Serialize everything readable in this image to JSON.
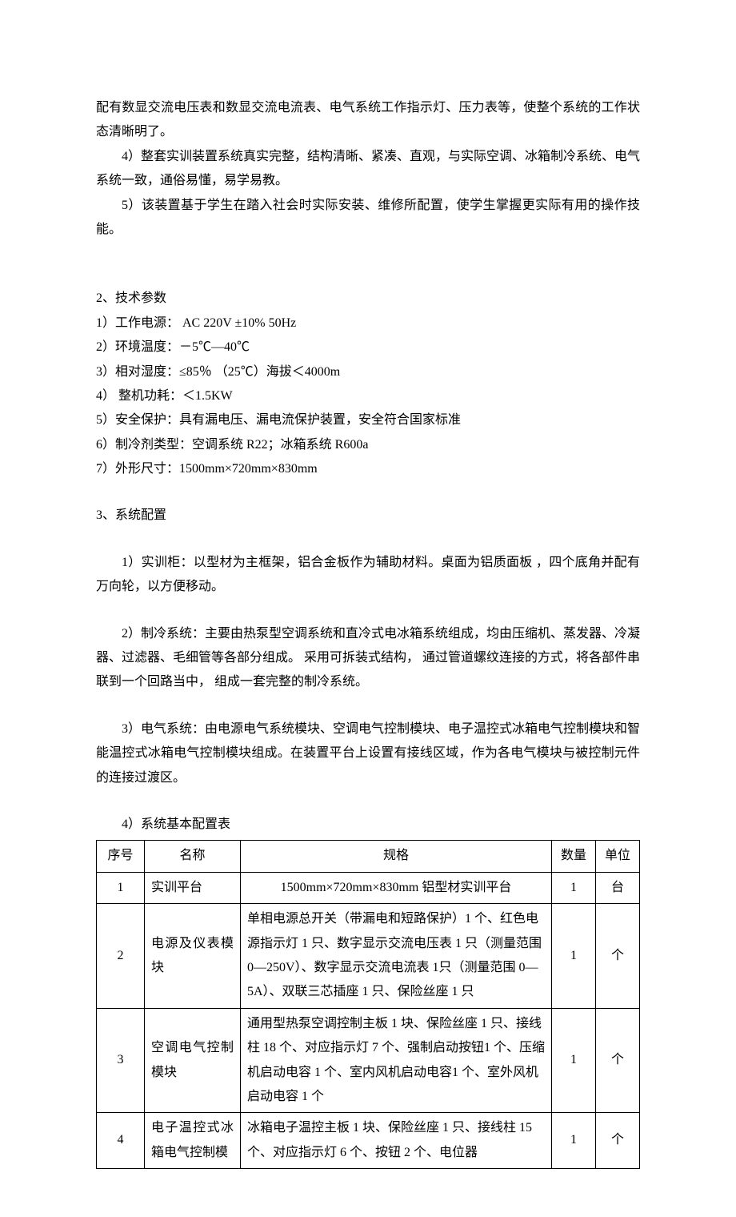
{
  "intro": {
    "p1": "配有数显交流电压表和数显交流电流表、电气系统工作指示灯、压力表等，使整个系统的工作状态清晰明了。",
    "p2": "4）整套实训装置系统真实完整，结构清晰、紧凑、直观，与实际空调、冰箱制冷系统、电气系统一致，通俗易懂，易学易教。",
    "p3": "5）该装置基于学生在踏入社会时实际安装、维修所配置，使学生掌握更实际有用的操作技能。"
  },
  "tech": {
    "title": "2、技术参数",
    "items": [
      "1）工作电源：  AC 220V  ±10%    50Hz",
      "2）环境温度：－5℃—40℃",
      "3）相对湿度：≤85％    （25℃）海拔＜4000m",
      "4）  整机功耗：＜1.5KW",
      "5）安全保护：具有漏电压、漏电流保护装置，安全符合国家标准",
      "6）制冷剂类型：空调系统 R22；冰箱系统 R600a",
      "7）外形尺寸：1500mm×720mm×830mm"
    ]
  },
  "config": {
    "title": "3、系统配置",
    "p1": "1）实训柜：以型材为主框架，铝合金板作为辅助材料。桌面为铝质面板 ，四个底角并配有万向轮，以方便移动。",
    "p2": "2）制冷系统：主要由热泵型空调系统和直冷式电冰箱系统组成，均由压缩机、蒸发器、冷凝器、过滤器、毛细管等各部分组成。  采用可拆装式结构，  通过管道螺纹连接的方式，将各部件串联到一个回路当中，  组成一套完整的制冷系统。",
    "p3": "3）电气系统：由电源电气系统模块、空调电气控制模块、电子温控式冰箱电气控制模块和智能温控式冰箱电气控制模块组成。在装置平台上设置有接线区域，作为各电气模块与被控制元件的连接过渡区。",
    "p4": "4）系统基本配置表"
  },
  "table": {
    "headers": {
      "idx": "序号",
      "name": "名称",
      "spec": "规格",
      "qty": "数量",
      "unit": "单位"
    },
    "rows": [
      {
        "idx": "1",
        "name": "实训平台",
        "spec": "1500mm×720mm×830mm 铝型材实训平台",
        "spec_center": true,
        "qty": "1",
        "unit": "台"
      },
      {
        "idx": "2",
        "name": "电源及仪表模块",
        "spec": "单相电源总开关（带漏电和短路保护）1 个、红色电源指示灯 1 只、数字显示交流电压表 1 只（测量范围 0—250V）、数字显示交流电流表 1只（测量范围 0—5A）、双联三芯插座 1 只、保险丝座 1 只",
        "qty": "1",
        "unit": "个"
      },
      {
        "idx": "3",
        "name": "空调电气控制模块",
        "spec": "通用型热泵空调控制主板 1 块、保险丝座 1 只、接线柱 18 个、对应指示灯 7 个、强制启动按钮1 个、压缩机启动电容 1 个、室内风机启动电容1 个、室外风机启动电容 1 个",
        "qty": "1",
        "unit": "个"
      },
      {
        "idx": "4",
        "name": "电子温控式冰箱电气控制模",
        "spec": "冰箱电子温控主板 1 块、保险丝座 1 只、接线柱 15 个、对应指示灯 6 个、按钮 2 个、电位器",
        "qty": "1",
        "unit": "个"
      }
    ]
  }
}
